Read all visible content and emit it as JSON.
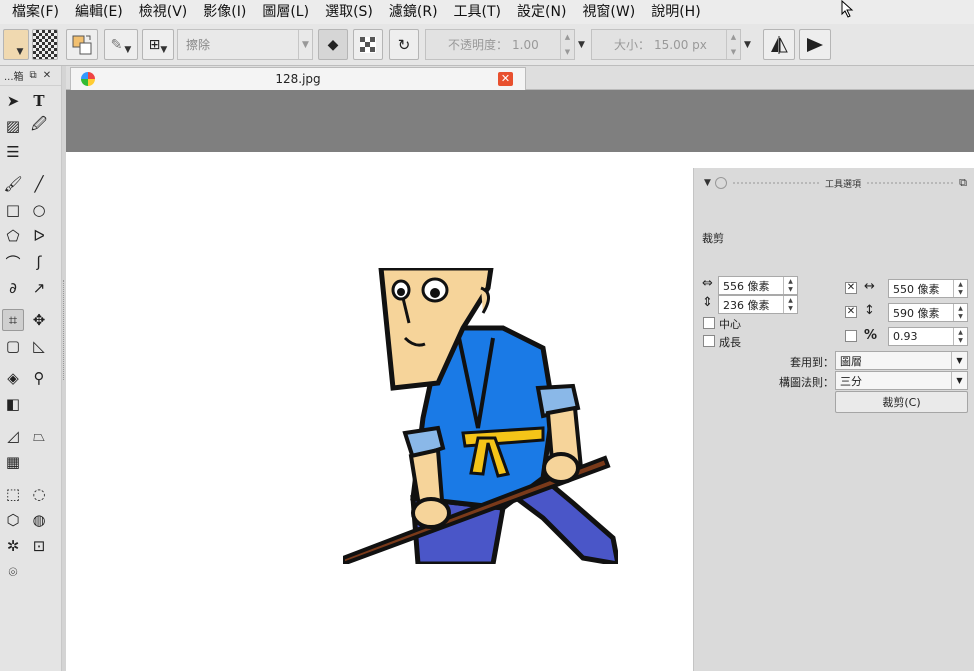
{
  "menu": [
    "檔案(F)",
    "編輯(E)",
    "檢視(V)",
    "影像(I)",
    "圖層(L)",
    "選取(S)",
    "濾鏡(R)",
    "工具(T)",
    "設定(N)",
    "視窗(W)",
    "說明(H)"
  ],
  "toolbar": {
    "erase_mode": "擦除",
    "opacity_label": "不透明度：",
    "opacity_value": "1.00",
    "size_label": "大小：",
    "size_value": "15.00 px"
  },
  "toolbox": {
    "title": "...箱"
  },
  "document_tab": {
    "filename": "128.jpg"
  },
  "tool_options": {
    "title": "工具選項",
    "tool_name": "裁剪",
    "width_value": "556 像素",
    "height_value": "236 像素",
    "x_value": "550 像素",
    "y_value": "590 像素",
    "center_label": "中心",
    "grow_label": "成長",
    "ratio_symbol": "%",
    "ratio_value": "0.93",
    "apply_to_label": "套用到：",
    "apply_to_value": "圖層",
    "composition_label": "構圖法則：",
    "composition_value": "三分",
    "crop_button": "裁剪(C)"
  },
  "colors": {
    "accent_close": "#e8502e",
    "canvas_gray": "#7f7f7f",
    "panel_bg": "#dadada"
  }
}
